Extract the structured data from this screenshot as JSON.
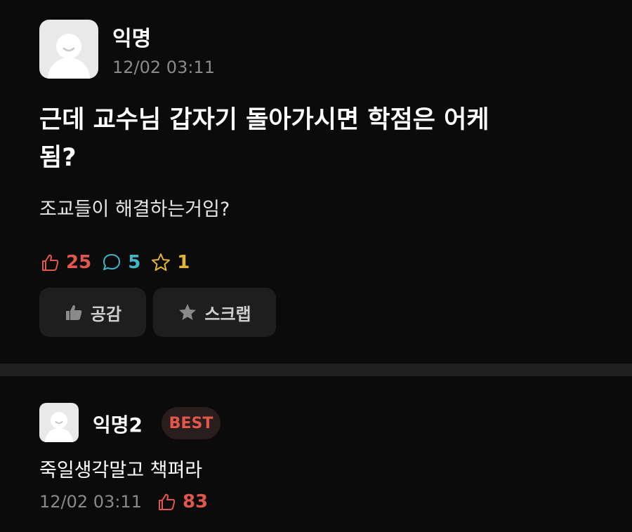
{
  "post": {
    "author": "익명",
    "timestamp": "12/02 03:11",
    "title": "근데 교수님 갑자기 돌아가시면 학점은 어케됨?",
    "body": "조교들이 해결하는거임?",
    "stats": {
      "likes": "25",
      "comments": "5",
      "scraps": "1"
    },
    "buttons": {
      "empathy": "공감",
      "scrap": "스크랩"
    }
  },
  "comment": {
    "author": "익명2",
    "badge": "BEST",
    "text": "죽일생각말고 책펴라",
    "timestamp": "12/02 03:11",
    "likes": "83"
  },
  "colors": {
    "like": "#e2574c",
    "comment": "#3fb6cc",
    "scrap": "#e0b43a",
    "background": "#0b0b0b"
  }
}
